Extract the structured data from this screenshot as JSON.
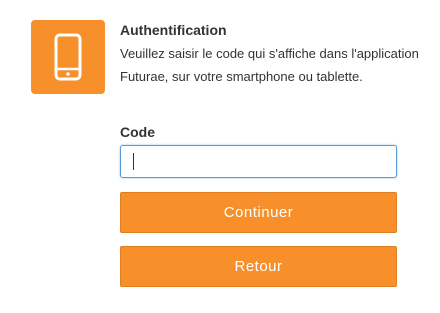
{
  "accent_color": "#f7902a",
  "icon": "smartphone-icon",
  "auth": {
    "title": "Authentification",
    "description": "Veuillez saisir le code qui s'affiche dans l'application Futurae, sur votre smartphone ou tablette."
  },
  "form": {
    "code_label": "Code",
    "code_value": ""
  },
  "buttons": {
    "continue_label": "Continuer",
    "back_label": "Retour"
  }
}
